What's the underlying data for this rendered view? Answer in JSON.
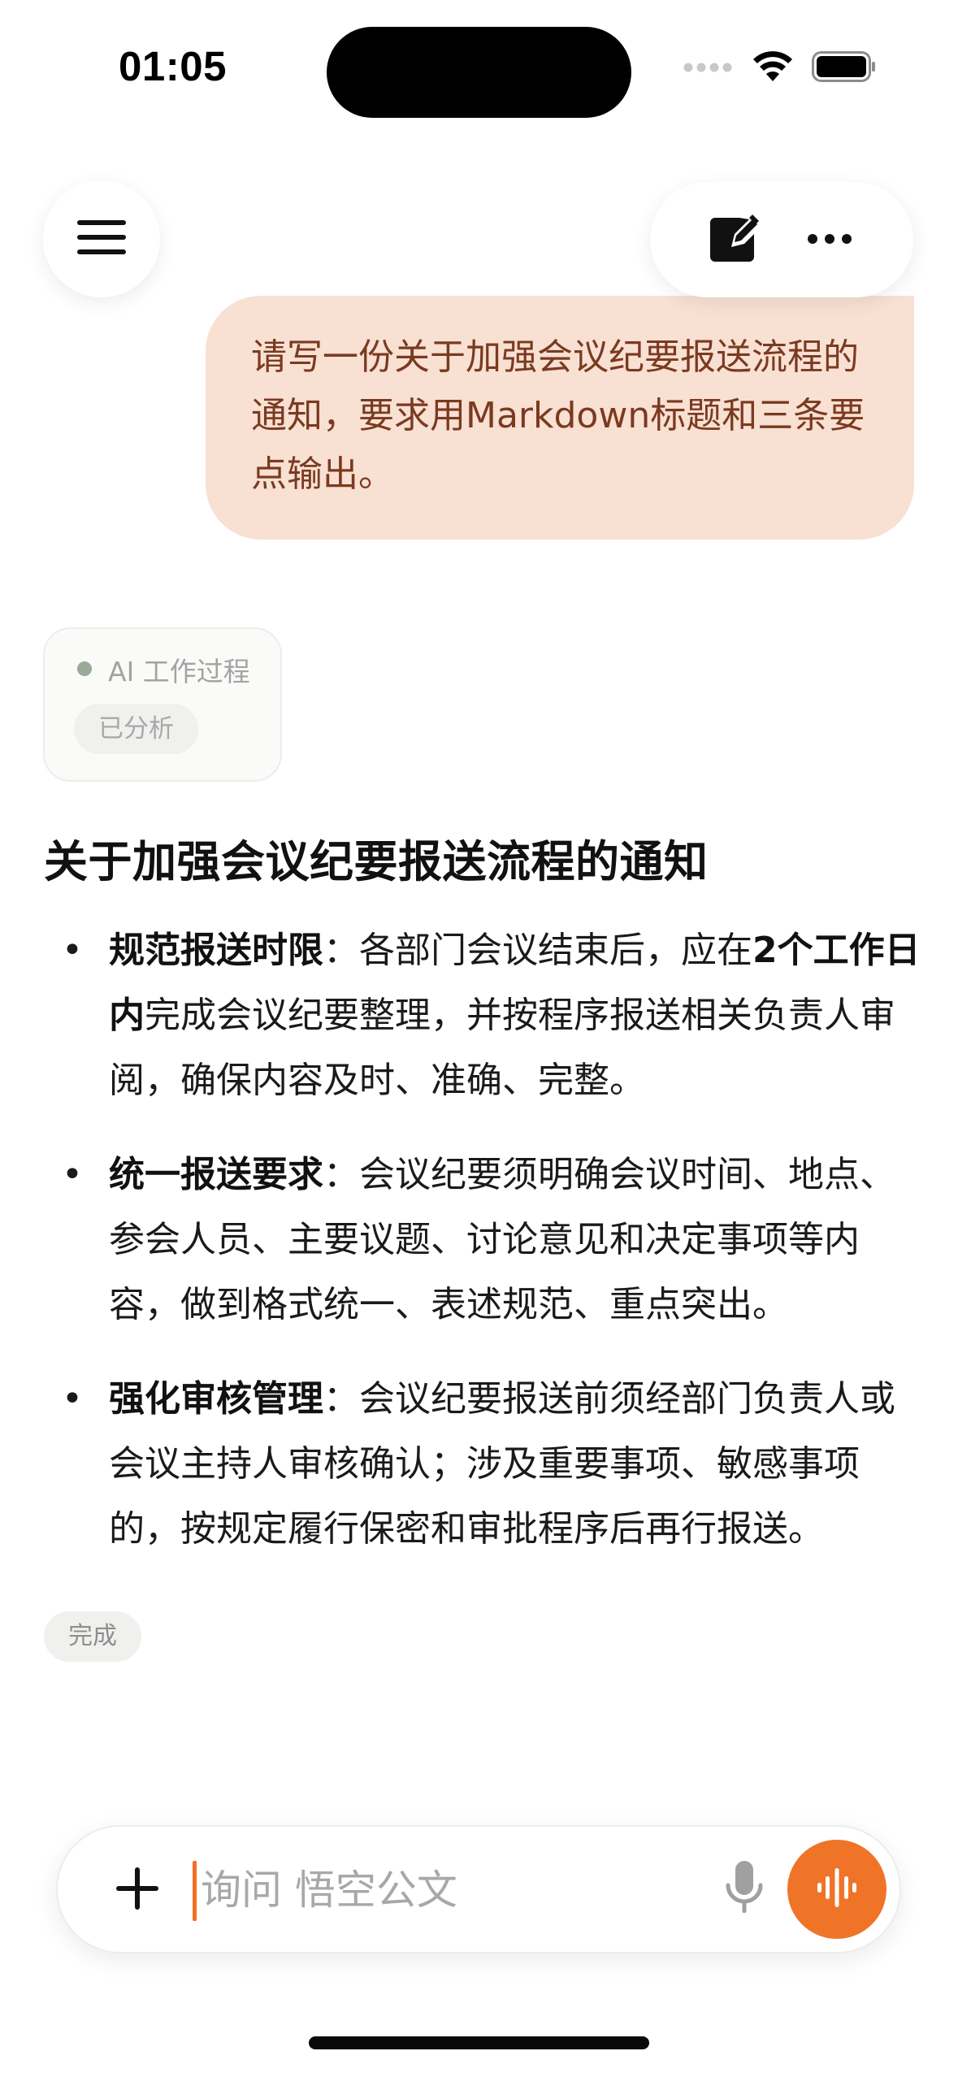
{
  "status_bar": {
    "time": "01:05",
    "icons": [
      "signal-dots-icon",
      "wifi-icon",
      "battery-icon"
    ]
  },
  "header": {
    "menu_icon": "hamburger-menu-icon",
    "new_chat_icon": "compose-icon",
    "more_icon": "more-horizontal-icon"
  },
  "user_message": {
    "text": "请写一份关于加强会议纪要报送流程的通知，要求用Markdown标题和三条要点输出。"
  },
  "ai_process": {
    "title": "AI 工作过程",
    "status": "已分析"
  },
  "answer": {
    "title": "关于加强会议纪要报送流程的通知",
    "items": [
      {
        "bold": "规范报送时限",
        "text_parts": [
          "：各部门会议结束后，应在",
          "2个工作日内",
          "完成会议纪要整理，并按程序报送相关负责人审阅，确保内容及时、准确、完整。"
        ]
      },
      {
        "bold": "统一报送要求",
        "text_parts": [
          "：会议纪要须明确会议时间、地点、参会人员、主要议题、讨论意见和决定事项等内容，做到格式统一、表述规范、重点突出。"
        ]
      },
      {
        "bold": "强化审核管理",
        "text_parts": [
          "：会议纪要报送前须经部门负责人或会议主持人审核确认；涉及重要事项、敏感事项的，按规定履行保密和审批程序后再行报送。"
        ]
      }
    ],
    "done_label": "完成"
  },
  "composer": {
    "placeholder": "询问 悟空公文",
    "plus_icon": "plus-icon",
    "mic_icon": "microphone-icon",
    "voice_icon": "voice-wave-icon",
    "accent_color": "#f07428"
  },
  "colors": {
    "user_bubble_bg": "#f8e0d3",
    "user_bubble_text": "#7a3a1f",
    "accent": "#f07428"
  }
}
